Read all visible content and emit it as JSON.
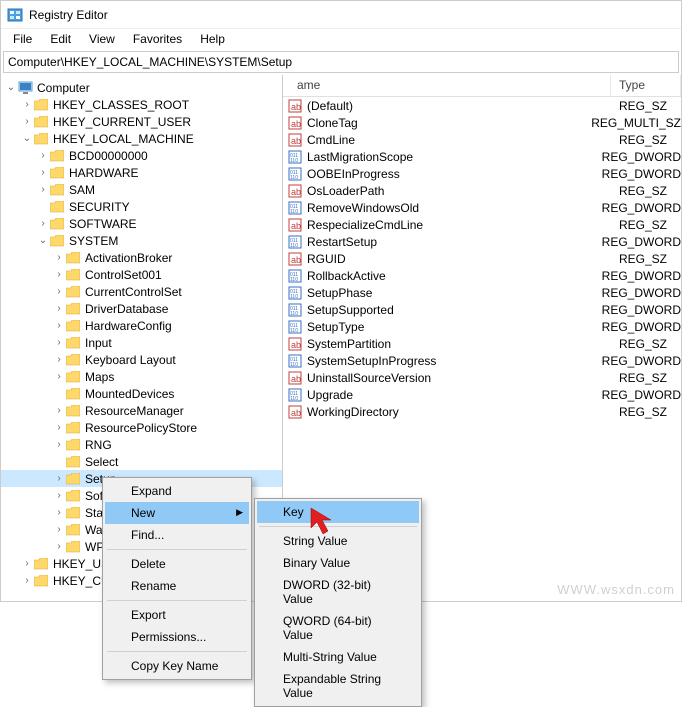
{
  "window": {
    "title": "Registry Editor"
  },
  "menubar": [
    "File",
    "Edit",
    "View",
    "Favorites",
    "Help"
  ],
  "address": "Computer\\HKEY_LOCAL_MACHINE\\SYSTEM\\Setup",
  "tree": [
    {
      "label": "Computer",
      "depth": 0,
      "exp": "open",
      "icon": "computer"
    },
    {
      "label": "HKEY_CLASSES_ROOT",
      "depth": 1,
      "exp": "closed"
    },
    {
      "label": "HKEY_CURRENT_USER",
      "depth": 1,
      "exp": "closed"
    },
    {
      "label": "HKEY_LOCAL_MACHINE",
      "depth": 1,
      "exp": "open"
    },
    {
      "label": "BCD00000000",
      "depth": 2,
      "exp": "closed"
    },
    {
      "label": "HARDWARE",
      "depth": 2,
      "exp": "closed"
    },
    {
      "label": "SAM",
      "depth": 2,
      "exp": "closed"
    },
    {
      "label": "SECURITY",
      "depth": 2,
      "exp": "none"
    },
    {
      "label": "SOFTWARE",
      "depth": 2,
      "exp": "closed"
    },
    {
      "label": "SYSTEM",
      "depth": 2,
      "exp": "open"
    },
    {
      "label": "ActivationBroker",
      "depth": 3,
      "exp": "closed"
    },
    {
      "label": "ControlSet001",
      "depth": 3,
      "exp": "closed"
    },
    {
      "label": "CurrentControlSet",
      "depth": 3,
      "exp": "closed"
    },
    {
      "label": "DriverDatabase",
      "depth": 3,
      "exp": "closed"
    },
    {
      "label": "HardwareConfig",
      "depth": 3,
      "exp": "closed"
    },
    {
      "label": "Input",
      "depth": 3,
      "exp": "closed"
    },
    {
      "label": "Keyboard Layout",
      "depth": 3,
      "exp": "closed"
    },
    {
      "label": "Maps",
      "depth": 3,
      "exp": "closed"
    },
    {
      "label": "MountedDevices",
      "depth": 3,
      "exp": "none"
    },
    {
      "label": "ResourceManager",
      "depth": 3,
      "exp": "closed"
    },
    {
      "label": "ResourcePolicyStore",
      "depth": 3,
      "exp": "closed"
    },
    {
      "label": "RNG",
      "depth": 3,
      "exp": "closed"
    },
    {
      "label": "Select",
      "depth": 3,
      "exp": "none"
    },
    {
      "label": "Setup",
      "depth": 3,
      "exp": "closed",
      "selected": true
    },
    {
      "label": "Softw",
      "depth": 3,
      "exp": "closed"
    },
    {
      "label": "State",
      "depth": 3,
      "exp": "closed"
    },
    {
      "label": "WaaS",
      "depth": 3,
      "exp": "closed"
    },
    {
      "label": "WPA",
      "depth": 3,
      "exp": "closed"
    },
    {
      "label": "HKEY_USE",
      "depth": 1,
      "exp": "closed"
    },
    {
      "label": "HKEY_CUR",
      "depth": 1,
      "exp": "closed"
    }
  ],
  "list_header": {
    "name": "ame",
    "type": "Type"
  },
  "values": [
    {
      "name": "(Default)",
      "type": "REG_SZ",
      "icon": "str"
    },
    {
      "name": "CloneTag",
      "type": "REG_MULTI_SZ",
      "icon": "str"
    },
    {
      "name": "CmdLine",
      "type": "REG_SZ",
      "icon": "str"
    },
    {
      "name": "LastMigrationScope",
      "type": "REG_DWORD",
      "icon": "bin"
    },
    {
      "name": "OOBEInProgress",
      "type": "REG_DWORD",
      "icon": "bin"
    },
    {
      "name": "OsLoaderPath",
      "type": "REG_SZ",
      "icon": "str"
    },
    {
      "name": "RemoveWindowsOld",
      "type": "REG_DWORD",
      "icon": "bin"
    },
    {
      "name": "RespecializeCmdLine",
      "type": "REG_SZ",
      "icon": "str"
    },
    {
      "name": "RestartSetup",
      "type": "REG_DWORD",
      "icon": "bin"
    },
    {
      "name": "RGUID",
      "type": "REG_SZ",
      "icon": "str"
    },
    {
      "name": "RollbackActive",
      "type": "REG_DWORD",
      "icon": "bin"
    },
    {
      "name": "SetupPhase",
      "type": "REG_DWORD",
      "icon": "bin"
    },
    {
      "name": "SetupSupported",
      "type": "REG_DWORD",
      "icon": "bin"
    },
    {
      "name": "SetupType",
      "type": "REG_DWORD",
      "icon": "bin"
    },
    {
      "name": "SystemPartition",
      "type": "REG_SZ",
      "icon": "str"
    },
    {
      "name": "SystemSetupInProgress",
      "type": "REG_DWORD",
      "icon": "bin"
    },
    {
      "name": "UninstallSourceVersion",
      "type": "REG_SZ",
      "icon": "str"
    },
    {
      "name": "Upgrade",
      "type": "REG_DWORD",
      "icon": "bin"
    },
    {
      "name": "WorkingDirectory",
      "type": "REG_SZ",
      "icon": "str"
    }
  ],
  "ctx1": {
    "expand": "Expand",
    "new": "New",
    "find": "Find...",
    "delete": "Delete",
    "rename": "Rename",
    "export": "Export",
    "permissions": "Permissions...",
    "copy_key_name": "Copy Key Name"
  },
  "ctx2": {
    "key": "Key",
    "string": "String Value",
    "binary": "Binary Value",
    "dword": "DWORD (32-bit) Value",
    "qword": "QWORD (64-bit) Value",
    "multi": "Multi-String Value",
    "expand": "Expandable String Value"
  },
  "watermark": "WWW.wsxdn.com"
}
